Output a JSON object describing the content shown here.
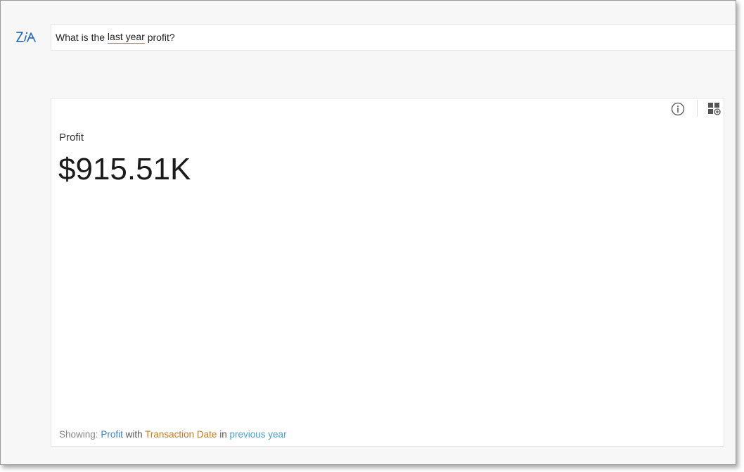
{
  "query": {
    "prefix": "What is the ",
    "highlighted": "last year",
    "suffix": " profit?"
  },
  "card": {
    "metric_label": "Profit",
    "metric_value": "$915.51K",
    "footer": {
      "showing_label": "Showing:",
      "measure": "Profit",
      "with_word": "with",
      "dimension": "Transaction Date",
      "in_word": "in",
      "period": "previous year"
    }
  },
  "icons": {
    "logo": "zia-logo",
    "info": "info-icon",
    "add_to_dashboard": "add-widget-icon"
  },
  "colors": {
    "logo": "#2f6db5",
    "highlight_underline": "#2aa8a0",
    "measure": "#3f7fc1",
    "dimension": "#c77a1e",
    "period": "#4aa0c8"
  }
}
